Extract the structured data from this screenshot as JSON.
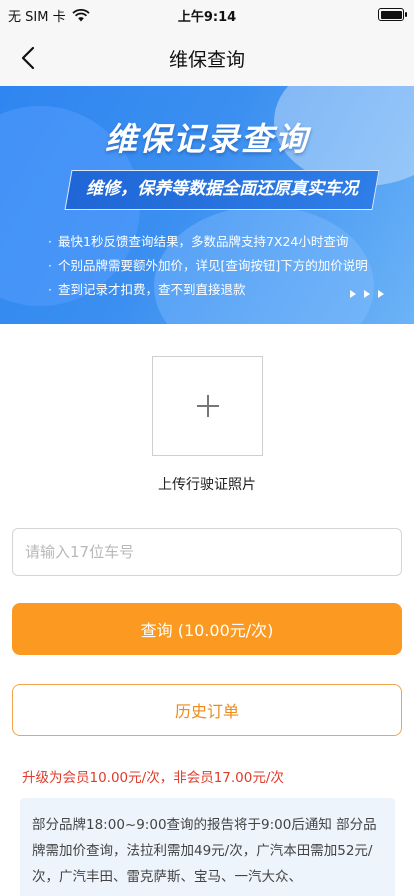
{
  "status_bar": {
    "carrier": "无 SIM 卡",
    "time": "上午9:14"
  },
  "nav": {
    "title": "维保查询"
  },
  "banner": {
    "title": "维保记录查询",
    "subtitle": "维修，保养等数据全面还原真实车况",
    "points": [
      "最快1秒反馈查询结果，多数品牌支持7X24小时查询",
      "个别品牌需要额外加价，详见[查询按钮]下方的加价说明",
      "查到记录才扣费，查不到直接退款"
    ]
  },
  "upload": {
    "label": "上传行驶证照片"
  },
  "vin": {
    "placeholder": "请输入17位车号",
    "value": ""
  },
  "query_button": {
    "label": "查询 (10.00元/次)"
  },
  "history_button": {
    "label": "历史订单"
  },
  "member_note": "升级为会员10.00元/次，非会员17.00元/次",
  "info_text": "部分品牌18:00~9:00查询的报告将于9:00后通知 部分品牌需加价查询，法拉利需加49元/次，广汽本田需加52元/次，广汽丰田、雷克萨斯、宝马、一汽大众、",
  "colors": {
    "accent": "#fb9920",
    "history_text": "#f08a1a",
    "warning": "#e13b2b",
    "banner_blue": "#2f86f0"
  }
}
